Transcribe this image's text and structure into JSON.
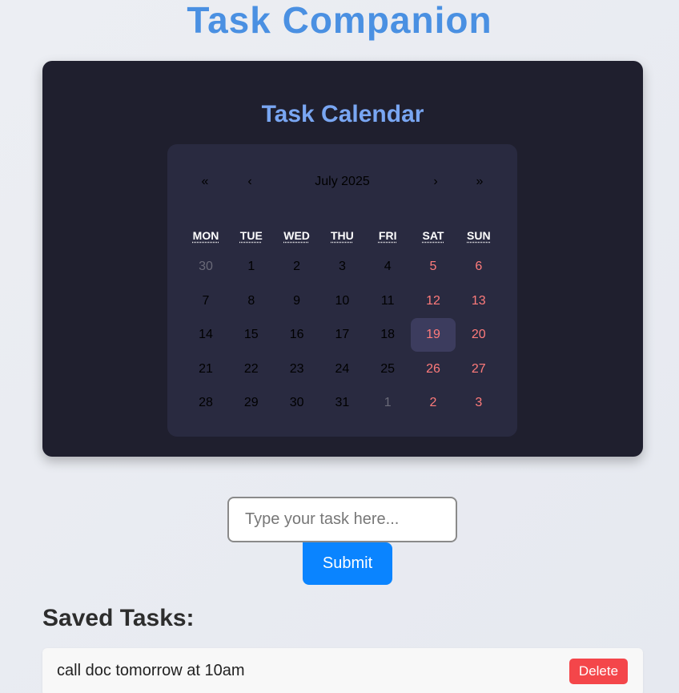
{
  "app": {
    "title": "Task Companion"
  },
  "calendar": {
    "heading": "Task Calendar",
    "nav": {
      "prev_year": "«",
      "prev_month": "‹",
      "next_month": "›",
      "next_year": "»"
    },
    "month_label": "July 2025",
    "weekdays": [
      "MON",
      "TUE",
      "WED",
      "THU",
      "FRI",
      "SAT",
      "SUN"
    ],
    "weekday_titles": [
      "Monday",
      "Tuesday",
      "Wednesday",
      "Thursday",
      "Friday",
      "Saturday",
      "Sunday"
    ],
    "weeks": [
      [
        "30",
        "1",
        "2",
        "3",
        "4",
        "5",
        "6"
      ],
      [
        "7",
        "8",
        "9",
        "10",
        "11",
        "12",
        "13"
      ],
      [
        "14",
        "15",
        "16",
        "17",
        "18",
        "19",
        "20"
      ],
      [
        "21",
        "22",
        "23",
        "24",
        "25",
        "26",
        "27"
      ],
      [
        "28",
        "29",
        "30",
        "31",
        "1",
        "2",
        "3"
      ]
    ],
    "today": "19",
    "colors": {
      "panel": "#1f1f2e",
      "calendar_bg": "#292a40",
      "weekend": "#ff7b7b",
      "heading": "#79a6f2",
      "today_bg": "#3c3c5e"
    }
  },
  "task_form": {
    "placeholder": "Type your task here...",
    "value": "",
    "submit_label": "Submit"
  },
  "saved": {
    "heading": "Saved Tasks:",
    "tasks": [
      {
        "text": "call doc tomorrow at 10am",
        "delete_label": "Delete"
      }
    ]
  },
  "colors": {
    "title": "#4a90e2",
    "submit": "#0a84ff",
    "delete": "#f4464a"
  }
}
